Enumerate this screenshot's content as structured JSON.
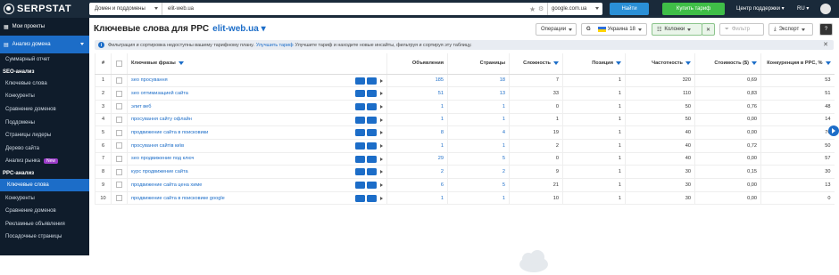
{
  "topbar": {
    "logo": "SERPSTAT",
    "search_scope": "Домен и поддомены",
    "search_query": "elit-web.ua",
    "database": "google.com.ua",
    "find_button": "Найти",
    "buy_button": "Купить тариф",
    "support": "Центр поддержки",
    "language": "RU"
  },
  "sidebar": {
    "projects": "Мои проекты",
    "domain_analysis": "Анализ домена",
    "items_top": [
      {
        "label": "Суммарный отчет"
      }
    ],
    "seo_section": "SEO-анализ",
    "seo_items": [
      {
        "label": "Ключевые слова"
      },
      {
        "label": "Конкуренты"
      },
      {
        "label": "Сравнение доменов"
      },
      {
        "label": "Поддомены"
      },
      {
        "label": "Страницы лидеры"
      },
      {
        "label": "Дерево сайта"
      },
      {
        "label": "Анализ рынка",
        "badge": "New"
      }
    ],
    "ppc_section": "PPC-анализ",
    "ppc_items": [
      {
        "label": "Ключевые слова",
        "active": true
      },
      {
        "label": "Конкуренты"
      },
      {
        "label": "Сравнение доменов"
      },
      {
        "label": "Рекламные объявления"
      },
      {
        "label": "Посадочные страницы"
      }
    ]
  },
  "header": {
    "title": "Ключевые слова для PPC",
    "domain": "elit-web.ua",
    "operations": "Операции",
    "region": "Украина",
    "region_num": "18",
    "columns": "Колонки",
    "filter": "Фильтр",
    "export": "Экспорт"
  },
  "notice": {
    "text1": "Фильтрация и сортировка недоступны вашему тарифному плану.",
    "link": "Улучшить тариф",
    "text2": "Улучшите тариф и находите новые инсайты, фильтруя и сортируя эту таблицу."
  },
  "table": {
    "headers": {
      "num": "#",
      "keyword": "Ключевые фразы",
      "ads": "Объявления",
      "pages": "Страницы",
      "difficulty": "Сложность",
      "position": "Позиция",
      "frequency": "Частотность",
      "cost": "Стоимость ($)",
      "competition": "Конкуренция в PPC, %"
    },
    "rows": [
      {
        "n": "1",
        "kw": "seo просування",
        "ads": "185",
        "pages": "18",
        "diff": "7",
        "pos": "1",
        "freq": "320",
        "cost": "0,69",
        "comp": "53"
      },
      {
        "n": "2",
        "kw": "seo оптимизацией сайта",
        "ads": "51",
        "pages": "13",
        "diff": "33",
        "pos": "1",
        "freq": "110",
        "cost": "0,83",
        "comp": "51"
      },
      {
        "n": "3",
        "kw": "элит веб",
        "ads": "1",
        "pages": "1",
        "diff": "0",
        "pos": "1",
        "freq": "50",
        "cost": "0,76",
        "comp": "48"
      },
      {
        "n": "4",
        "kw": "просування сайту офлайн",
        "ads": "1",
        "pages": "1",
        "diff": "1",
        "pos": "1",
        "freq": "50",
        "cost": "0,00",
        "comp": "14"
      },
      {
        "n": "5",
        "kw": "продвижение сайта в поисковики",
        "ads": "8",
        "pages": "4",
        "diff": "19",
        "pos": "1",
        "freq": "40",
        "cost": "0,00",
        "comp": "76"
      },
      {
        "n": "6",
        "kw": "просування сайтів київ",
        "ads": "1",
        "pages": "1",
        "diff": "2",
        "pos": "1",
        "freq": "40",
        "cost": "0,72",
        "comp": "50"
      },
      {
        "n": "7",
        "kw": "seo продвижение под ключ",
        "ads": "29",
        "pages": "5",
        "diff": "0",
        "pos": "1",
        "freq": "40",
        "cost": "0,00",
        "comp": "57"
      },
      {
        "n": "8",
        "kw": "курс продвижение сайта",
        "ads": "2",
        "pages": "2",
        "diff": "9",
        "pos": "1",
        "freq": "30",
        "cost": "0,15",
        "comp": "30"
      },
      {
        "n": "9",
        "kw": "продвижение сайта цена химе",
        "ads": "6",
        "pages": "5",
        "diff": "21",
        "pos": "1",
        "freq": "30",
        "cost": "0,00",
        "comp": "13"
      },
      {
        "n": "10",
        "kw": "продвижение сайта в поисковике google",
        "ads": "1",
        "pages": "1",
        "diff": "10",
        "pos": "1",
        "freq": "30",
        "cost": "0,00",
        "comp": "0"
      }
    ]
  }
}
